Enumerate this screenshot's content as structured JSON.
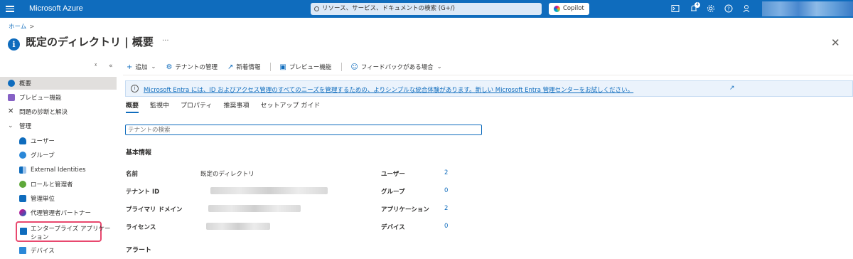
{
  "topbar": {
    "brand": "Microsoft Azure",
    "search_placeholder": "リソース、サービス、ドキュメントの検索 (G+/)",
    "copilot_label": "Copilot",
    "notification_count": "4",
    "icons": [
      "hamburger-icon",
      "search-icon",
      "terminal-icon",
      "bell-icon",
      "gear-icon",
      "help-icon",
      "feedback-icon"
    ],
    "bar_color": "#0f6cbd"
  },
  "breadcrumb": {
    "home": "ホーム",
    "sep": ">"
  },
  "page": {
    "title": "既定のディレクトリ | 概要",
    "more": "···",
    "close": "✕"
  },
  "sidebar": {
    "expand": "ᵡ",
    "collapse": "«",
    "items": [
      {
        "label": "概要",
        "icon": "info-icon"
      },
      {
        "label": "プレビュー機能",
        "icon": "preview-icon"
      },
      {
        "label": "問題の診断と解決",
        "icon": "wrench-icon"
      },
      {
        "label": "管理",
        "icon": "chevron-down-icon"
      },
      {
        "label": "ユーザー",
        "icon": "user-icon"
      },
      {
        "label": "グループ",
        "icon": "group-icon"
      },
      {
        "label": "External Identities",
        "icon": "external-icon"
      },
      {
        "label": "ロールと管理者",
        "icon": "role-icon"
      },
      {
        "label": "管理単位",
        "icon": "admin-unit-icon"
      },
      {
        "label": "代理管理者パートナー",
        "icon": "partner-icon"
      },
      {
        "label": "エンタープライズ アプリケーション",
        "icon": "enterprise-app-icon"
      },
      {
        "label": "デバイス",
        "icon": "device-icon"
      }
    ],
    "enterprise_line1": "エンタープライズ アプリケー",
    "enterprise_line2": "ション"
  },
  "toolbar": {
    "add": "追加",
    "tenant_manage": "テナントの管理",
    "whats_new": "新着情報",
    "preview": "プレビュー機能",
    "feedback": "フィードバックがある場合"
  },
  "banner": {
    "text": "Microsoft Entra には、ID およびアクセス管理のすべてのニーズを管理するための、よりシンプルな統合体験があります。新しい Microsoft Entra 管理センターをお試しください。"
  },
  "tabs": [
    "概要",
    "監視中",
    "プロパティ",
    "推奨事項",
    "セットアップ ガイド"
  ],
  "tenant_search_placeholder": "テナントの検索",
  "basic_info": {
    "title": "基本情報",
    "name_label": "名前",
    "name_value": "既定のディレクトリ",
    "tenant_id_label": "テナント ID",
    "primary_domain_label": "プライマリ ドメイン",
    "license_label": "ライセンス",
    "users_label": "ユーザー",
    "users_value": "2",
    "groups_label": "グループ",
    "groups_value": "0",
    "apps_label": "アプリケーション",
    "apps_value": "2",
    "devices_label": "デバイス",
    "devices_value": "0"
  },
  "alerts_title": "アラート"
}
